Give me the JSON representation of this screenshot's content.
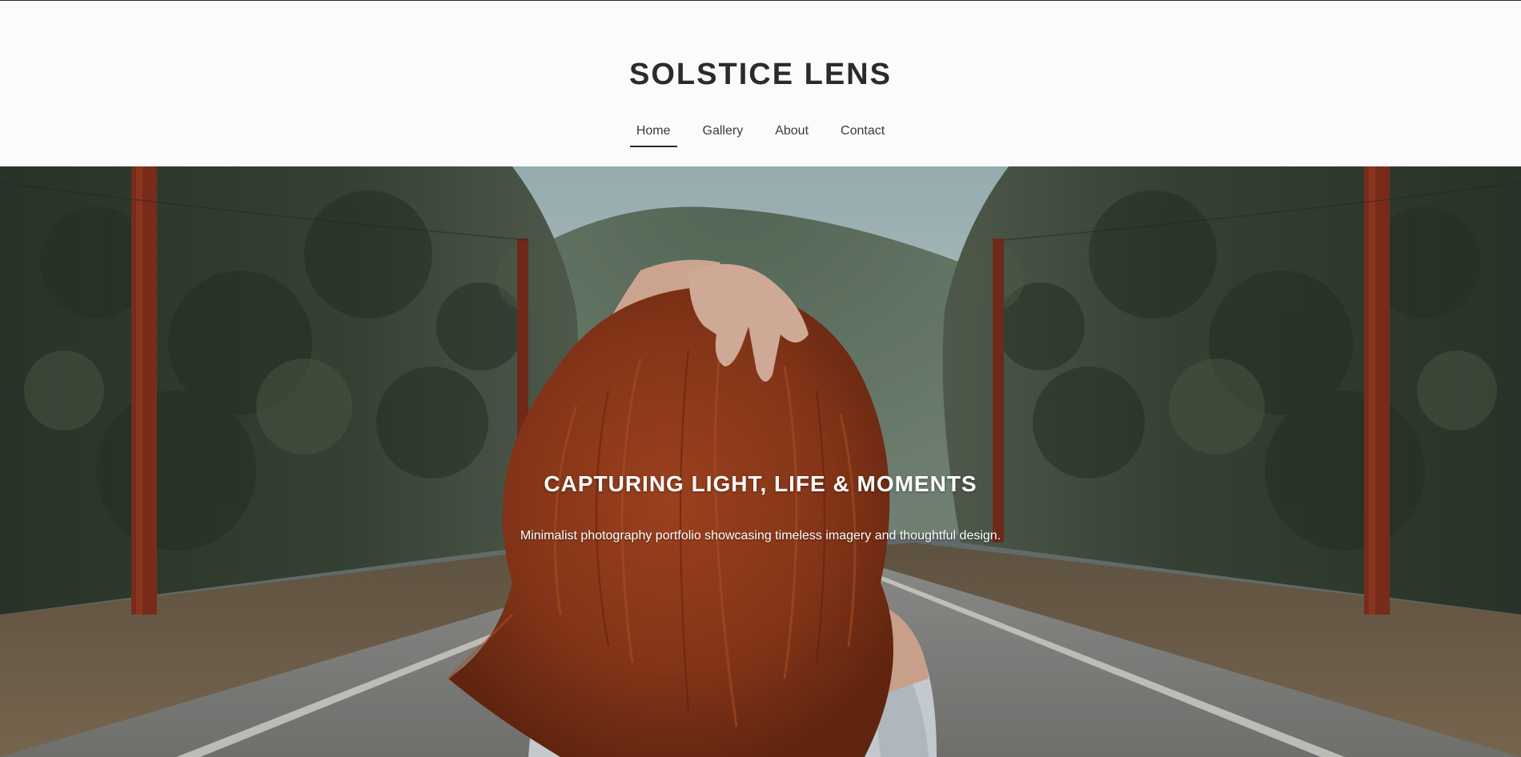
{
  "site": {
    "title": "SOLSTICE LENS"
  },
  "nav": {
    "items": [
      {
        "label": "Home",
        "active": true
      },
      {
        "label": "Gallery",
        "active": false
      },
      {
        "label": "About",
        "active": false
      },
      {
        "label": "Contact",
        "active": false
      }
    ]
  },
  "hero": {
    "heading": "CAPTURING LIGHT, LIFE & MOMENTS",
    "subtext": "Minimalist photography portfolio showcasing timeless imagery and thoughtful design.",
    "image_subject": "woman-with-red-hair-on-forest-road"
  },
  "colors": {
    "header_bg": "#fbfbfb",
    "title_text": "#2b2b2b",
    "nav_text": "#3b3b3b",
    "hero_text": "#ffffff",
    "hair": "#a0421f",
    "forest": "#3e4a3c",
    "road": "#8c8c8a",
    "sky": "#b8ccd0"
  }
}
